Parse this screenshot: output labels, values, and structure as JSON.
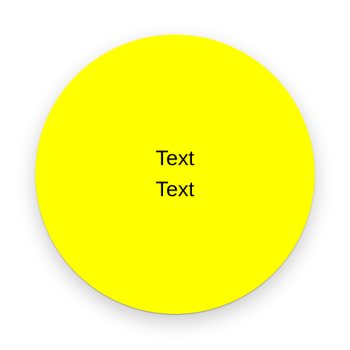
{
  "circle": {
    "color": "#ffff00",
    "lines": [
      "Text",
      "Text"
    ]
  }
}
